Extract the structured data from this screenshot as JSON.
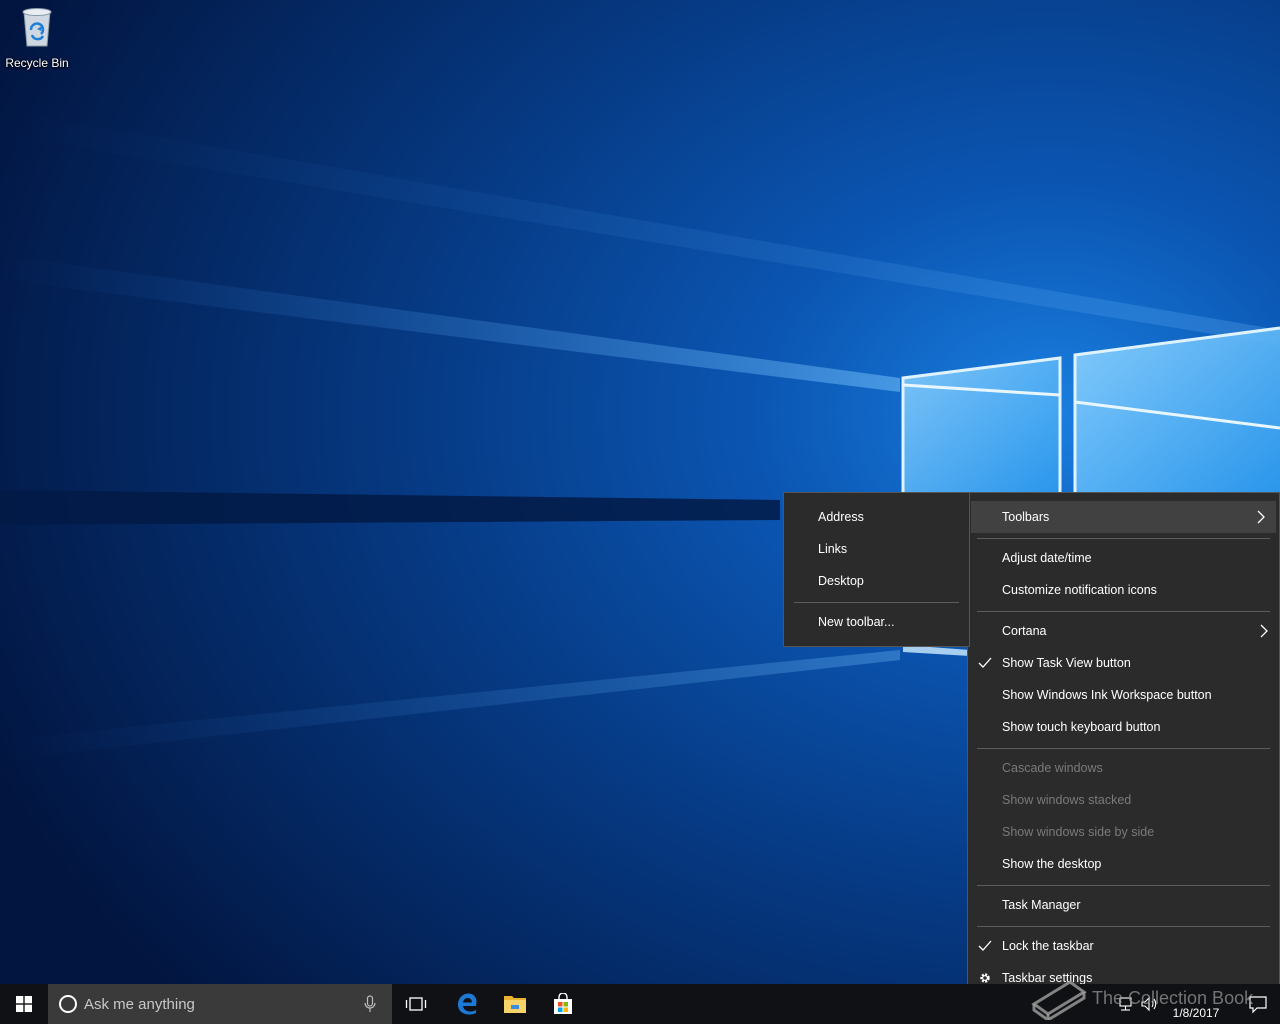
{
  "desktop": {
    "icons": [
      {
        "label": "Recycle Bin",
        "icon": "recycle-bin-icon"
      }
    ]
  },
  "taskbar_menu": {
    "items": {
      "toolbars": "Toolbars",
      "adjust_datetime": "Adjust date/time",
      "customize_notification_icons": "Customize notification icons",
      "cortana": "Cortana",
      "show_task_view": "Show Task View button",
      "show_ink_workspace": "Show Windows Ink Workspace button",
      "show_touch_keyboard": "Show touch keyboard button",
      "cascade_windows": "Cascade windows",
      "show_windows_stacked": "Show windows stacked",
      "show_windows_side_by_side": "Show windows side by side",
      "show_desktop": "Show the desktop",
      "task_manager": "Task Manager",
      "lock_taskbar": "Lock the taskbar",
      "taskbar_settings": "Taskbar settings"
    },
    "checked": [
      "Show Task View button",
      "Lock the taskbar"
    ],
    "disabled": [
      "Cascade windows",
      "Show windows stacked",
      "Show windows side by side"
    ],
    "highlighted": "Toolbars"
  },
  "toolbars_submenu": {
    "items": {
      "address": "Address",
      "links": "Links",
      "desktop": "Desktop",
      "new_toolbar": "New toolbar..."
    }
  },
  "taskbar": {
    "search_placeholder": "Ask me anything",
    "pinned_apps": [
      "edge-icon",
      "file-explorer-icon",
      "store-icon"
    ],
    "clock_date": "1/8/2017"
  },
  "watermark": {
    "text": "The Collection Book"
  },
  "colors": {
    "menu_bg": "#2b2b2b",
    "menu_highlight": "#414141",
    "taskbar_bg": "#101114",
    "accent": "#0078d7"
  }
}
